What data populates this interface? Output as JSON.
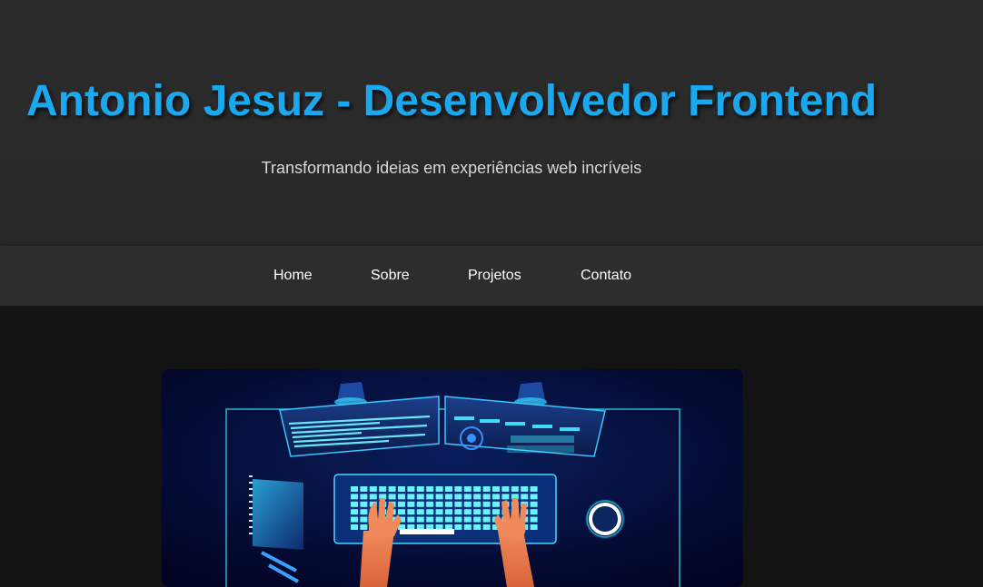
{
  "header": {
    "title": "Antonio Jesuz - Desenvolvedor Frontend",
    "subtitle": "Transformando ideias em experiências web incríveis"
  },
  "nav": {
    "items": [
      {
        "label": "Home"
      },
      {
        "label": "Sobre"
      },
      {
        "label": "Projetos"
      },
      {
        "label": "Contato"
      }
    ]
  },
  "image": {
    "semantic": "developer-desk-illustration-image"
  },
  "colors": {
    "title": "#1aa8ef",
    "header_bg": "#2a2a2a",
    "nav_bg": "#2d2d2d",
    "page_bg": "#131313",
    "accent_cyan": "#2ee6f0"
  }
}
